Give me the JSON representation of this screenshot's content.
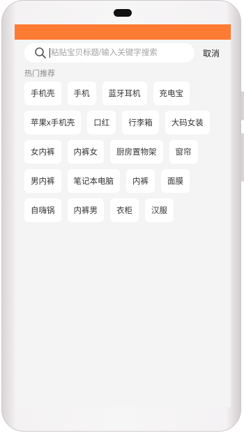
{
  "search": {
    "placeholder": "粘贴宝贝标题/输入关键字搜索",
    "cancel_label": "取消"
  },
  "hot": {
    "title": "热门推荐",
    "rows": [
      [
        "手机壳",
        "手机",
        "蓝牙耳机",
        "充电宝"
      ],
      [
        "苹果x手机壳",
        "口红",
        "行李箱",
        "大码女装"
      ],
      [
        "女内裤",
        "内裤女",
        "厨房置物架",
        "窗帘"
      ],
      [
        "男内裤",
        "笔记本电脑",
        "内裤",
        "面膜"
      ],
      [
        "自嗨锅",
        "内裤男",
        "衣柜",
        "汉服"
      ]
    ]
  },
  "colors": {
    "accent": "#ff7a33",
    "background": "#f4f4f4",
    "tag_bg": "#ffffff"
  },
  "icons": {
    "search": "search-icon"
  }
}
